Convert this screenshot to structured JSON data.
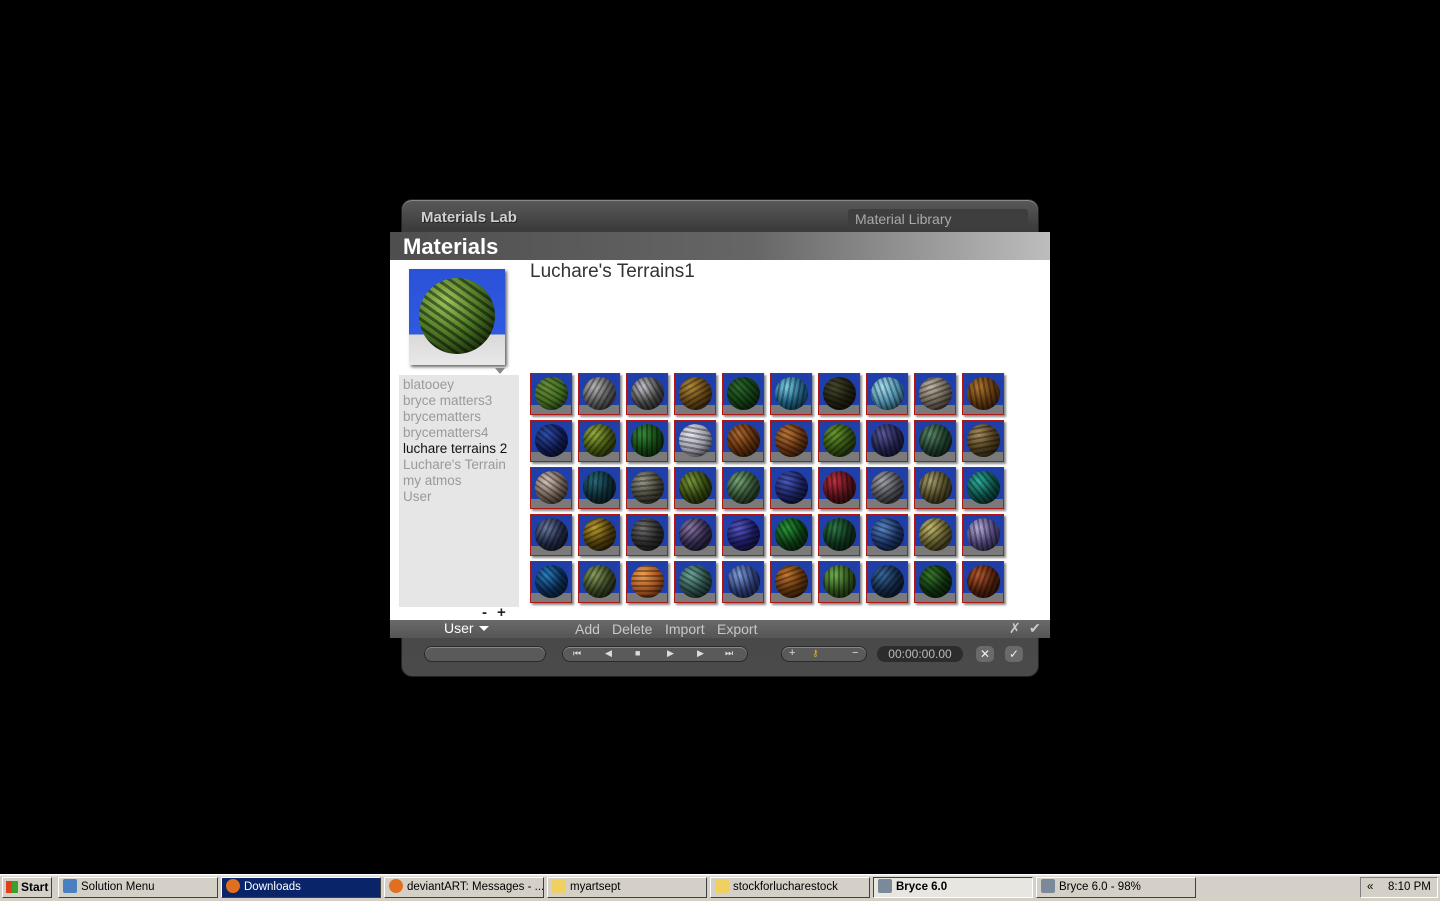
{
  "lab": {
    "title": "Materials Lab",
    "library_tab": "Material Library"
  },
  "dialog": {
    "title": "Materials",
    "material_name": "Luchare's Terrains1",
    "libraries": [
      "blatooey",
      "bryce matters3",
      "brycematters",
      "brycematters4",
      "luchare terrains 2",
      "Luchare's Terrain",
      "my atmos",
      "User"
    ],
    "active_library_index": 4,
    "list_minus": "-",
    "list_plus": "+",
    "footer": {
      "user": "User",
      "add": "Add",
      "delete": "Delete",
      "import": "Import",
      "export": "Export"
    }
  },
  "swatches": [
    [
      "#6b8f3a",
      "#3f6a20",
      30
    ],
    [
      "#b8b8b8",
      "#555",
      120
    ],
    [
      "#c8c8d0",
      "#444",
      60
    ],
    [
      "#b48a3a",
      "#5c4014",
      150
    ],
    [
      "#2e6b2e",
      "#133a13",
      45
    ],
    [
      "#7ad0e8",
      "#1e5a7a",
      100
    ],
    [
      "#4a4a30",
      "#1d1d10",
      20
    ],
    [
      "#a8e0f0",
      "#4a8aa8",
      70
    ],
    [
      "#c0b8a8",
      "#6a6054",
      160
    ],
    [
      "#b07830",
      "#5a3410",
      80
    ],
    [
      "#3050b0",
      "#101a50",
      40
    ],
    [
      "#98b040",
      "#3e5010",
      130
    ],
    [
      "#3a8a3a",
      "#124012",
      90
    ],
    [
      "#e8e8f0",
      "#9a9aa8",
      10
    ],
    [
      "#b06a30",
      "#5a2c0c",
      55
    ],
    [
      "#c07838",
      "#603010",
      25
    ],
    [
      "#6a9a30",
      "#2e4a10",
      140
    ],
    [
      "#5a5a9a",
      "#20204a",
      75
    ],
    [
      "#5a8a6a",
      "#1e3a28",
      110
    ],
    [
      "#a89060",
      "#4a3a1a",
      170
    ],
    [
      "#d8c8c0",
      "#6a5a50",
      35
    ],
    [
      "#2a6a7a",
      "#0c2a32",
      95
    ],
    [
      "#9a9a8a",
      "#404036",
      175
    ],
    [
      "#7a9a3a",
      "#30420e",
      65
    ],
    [
      "#78a878",
      "#2e4a2e",
      125
    ],
    [
      "#4a5ac0",
      "#18205a",
      15
    ],
    [
      "#c03040",
      "#501018",
      85
    ],
    [
      "#a8a8b0",
      "#484850",
      145
    ],
    [
      "#a8a070",
      "#4a4424",
      105
    ],
    [
      "#30b0a0",
      "#0c4a42",
      50
    ],
    [
      "#6a7aa0",
      "#1e2640",
      115
    ],
    [
      "#c0a030",
      "#4a3a0a",
      155
    ],
    [
      "#707070",
      "#282828",
      5
    ],
    [
      "#8a7aa8",
      "#30284a",
      135
    ],
    [
      "#5a5ac8",
      "#1a1a60",
      165
    ],
    [
      "#2a9a3a",
      "#0a3a12",
      60
    ],
    [
      "#2e7a4a",
      "#0e301a",
      100
    ],
    [
      "#5a8ac8",
      "#1a3060",
      20
    ],
    [
      "#c8c070",
      "#5a5428",
      140
    ],
    [
      "#b8b0e0",
      "#4a4070",
      80
    ],
    [
      "#2a80c8",
      "#0a2a50",
      45
    ],
    [
      "#8aa060",
      "#344020",
      120
    ],
    [
      "#f0a050",
      "#a05020",
      180
    ],
    [
      "#70a8a0",
      "#2a4a44",
      30
    ],
    [
      "#80a0e0",
      "#2a3a70",
      75
    ],
    [
      "#c87a30",
      "#5a300c",
      160
    ],
    [
      "#70b050",
      "#2a4a18",
      90
    ],
    [
      "#3a6aa0",
      "#102440",
      130
    ],
    [
      "#3a7a30",
      "#0e2e0c",
      40
    ],
    [
      "#b85a30",
      "#4a1e0c",
      110
    ]
  ]
}
